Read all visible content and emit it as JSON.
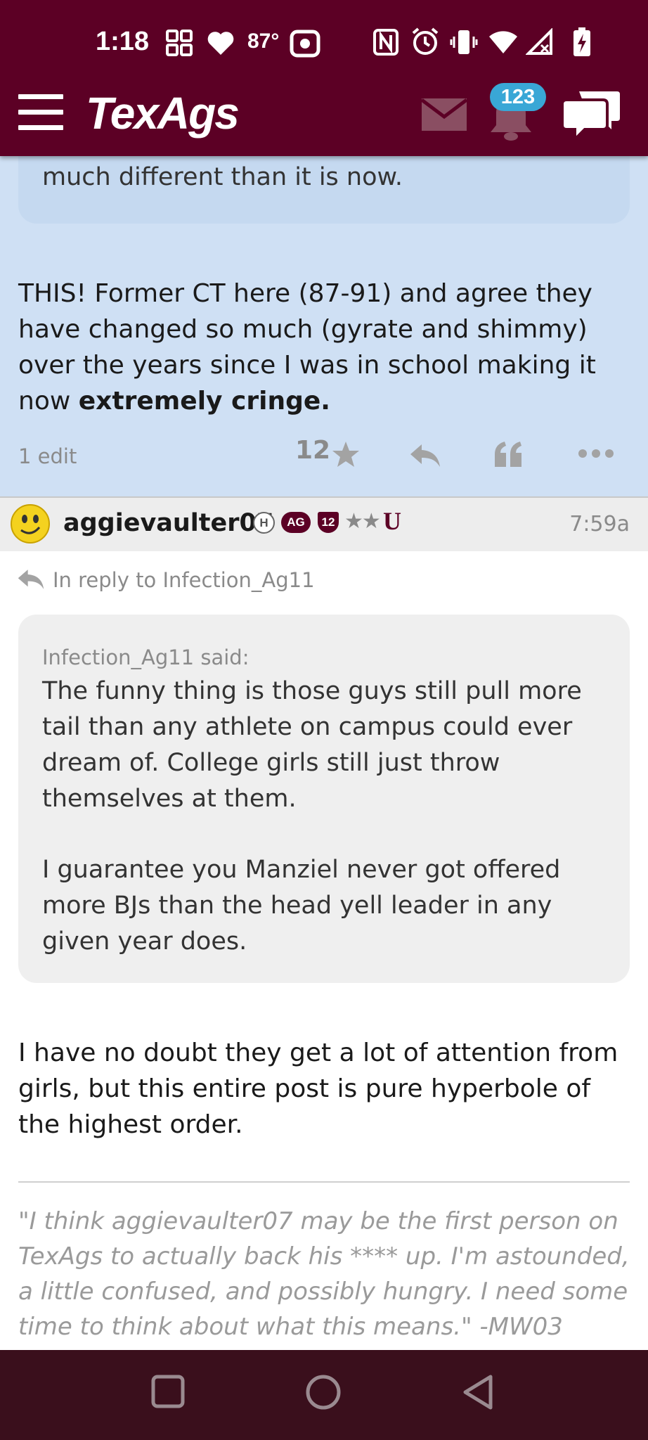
{
  "status_bar": {
    "time": "1:18",
    "temperature": "87°",
    "icons": [
      "qr-grid-icon",
      "heart-icon",
      "screen-record-icon",
      "nfc-icon",
      "alarm-icon",
      "vibrate-icon",
      "wifi-icon",
      "signal-icon",
      "battery-charging-icon"
    ]
  },
  "app_bar": {
    "logo": "TexAgs",
    "notification_count": "123",
    "icons": [
      "menu-icon",
      "mail-icon",
      "bell-icon",
      "chat-icon"
    ]
  },
  "post_above": {
    "quote_tail": "much different than it is now.",
    "body_plain": "THIS! Former CT here (87-91) and agree they have changed so much (gyrate and shimmy) over the years since I was in school making it now",
    "body_bold": "extremely cringe.",
    "edit_note": "1 edit",
    "star_count": "12"
  },
  "post": {
    "username": "aggievaulter07",
    "badges": [
      "H",
      "AG",
      "12"
    ],
    "stars": "★★",
    "time": "7:59a",
    "reply_to": "In reply to Infection_Ag11",
    "quote_author": "Infection_Ag11 said:",
    "quote_p1": "The funny thing is those guys still pull more tail than any athlete on campus could ever dream of. College girls still just throw themselves at them.",
    "quote_p2": "I guarantee you Manziel never got offered more BJs than the head yell leader in any given year does.",
    "body": "I have no doubt they get a lot of attention from girls, but this entire post is pure hyperbole of the highest order.",
    "signature": "\"I think aggievaulter07 may be the first person on TexAgs to actually back his **** up. I'm astounded, a little confused, and possibly hungry. I need some time to think about what this means.\" -MW03"
  },
  "colors": {
    "maroon": "#5c0025",
    "highlight_blue": "#cfe0f4",
    "badge_blue": "#39a7d6",
    "nav_bar": "#3a0f1c"
  }
}
